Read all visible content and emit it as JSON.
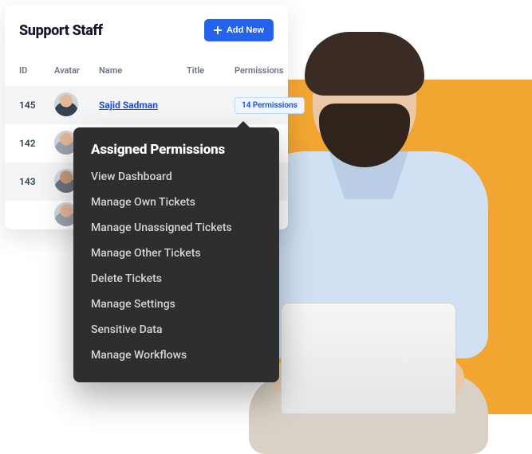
{
  "colors": {
    "accent": "#2563eb",
    "backdrop": "#F2A531",
    "popover": "#2e2e2e"
  },
  "card": {
    "title": "Support Staff",
    "add_label": "Add New"
  },
  "table": {
    "headers": {
      "id": "ID",
      "avatar": "Avatar",
      "name": "Name",
      "title": "Title",
      "permissions": "Permissions"
    },
    "rows": [
      {
        "id": "145",
        "avatar": "avatar-1",
        "name": "Sajid Sadman",
        "title": "",
        "permissions_badge": "14 Permissions"
      },
      {
        "id": "142",
        "avatar": "avatar-2",
        "name": "",
        "title": "",
        "permissions_badge": ""
      },
      {
        "id": "143",
        "avatar": "avatar-3",
        "name": "",
        "title": "",
        "permissions_badge": ""
      },
      {
        "id": "",
        "avatar": "avatar-4",
        "name": "",
        "title": "",
        "permissions_badge": ""
      }
    ]
  },
  "popover": {
    "title": "Assigned Permissions",
    "items": [
      "View Dashboard",
      "Manage Own Tickets",
      "Manage Unassigned Tickets",
      "Manage Other Tickets",
      "Delete Tickets",
      "Manage Settings",
      "Sensitive Data",
      "Manage Workflows"
    ]
  }
}
